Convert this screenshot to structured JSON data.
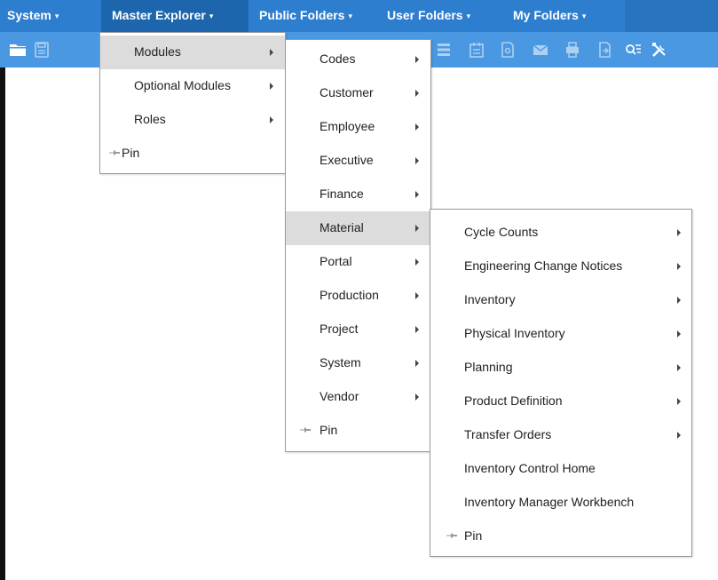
{
  "menubar": {
    "items": [
      {
        "label": "System"
      },
      {
        "label": "Master Explorer"
      },
      {
        "label": "Public Folders"
      },
      {
        "label": "User Folders"
      },
      {
        "label": "My Folders"
      }
    ],
    "caret": "▾"
  },
  "toolbar": {
    "icons": [
      "folder-icon",
      "save-icon",
      "list-icon",
      "calendar-icon",
      "document-search-icon",
      "mail-icon",
      "printer-icon",
      "export-icon",
      "search-list-icon",
      "tools-icon"
    ]
  },
  "menu1": {
    "items": [
      {
        "label": "Modules"
      },
      {
        "label": "Optional Modules"
      },
      {
        "label": "Roles"
      },
      {
        "label": "Pin"
      }
    ]
  },
  "menu2": {
    "items": [
      {
        "label": "Codes"
      },
      {
        "label": "Customer"
      },
      {
        "label": "Employee"
      },
      {
        "label": "Executive"
      },
      {
        "label": "Finance"
      },
      {
        "label": "Material"
      },
      {
        "label": "Portal"
      },
      {
        "label": "Production"
      },
      {
        "label": "Project"
      },
      {
        "label": "System"
      },
      {
        "label": "Vendor"
      },
      {
        "label": "Pin"
      }
    ]
  },
  "menu3": {
    "items": [
      {
        "label": "Cycle Counts"
      },
      {
        "label": "Engineering Change Notices"
      },
      {
        "label": "Inventory"
      },
      {
        "label": "Physical Inventory"
      },
      {
        "label": "Planning"
      },
      {
        "label": "Product Definition"
      },
      {
        "label": "Transfer Orders"
      },
      {
        "label": "Inventory Control Home"
      },
      {
        "label": "Inventory Manager Workbench"
      },
      {
        "label": "Pin"
      }
    ]
  },
  "colors": {
    "menubar": "#2e7ecf",
    "menubar_active": "#1d66ad",
    "toolbar": "#4a98e2",
    "highlight": "#dcdcdc"
  }
}
